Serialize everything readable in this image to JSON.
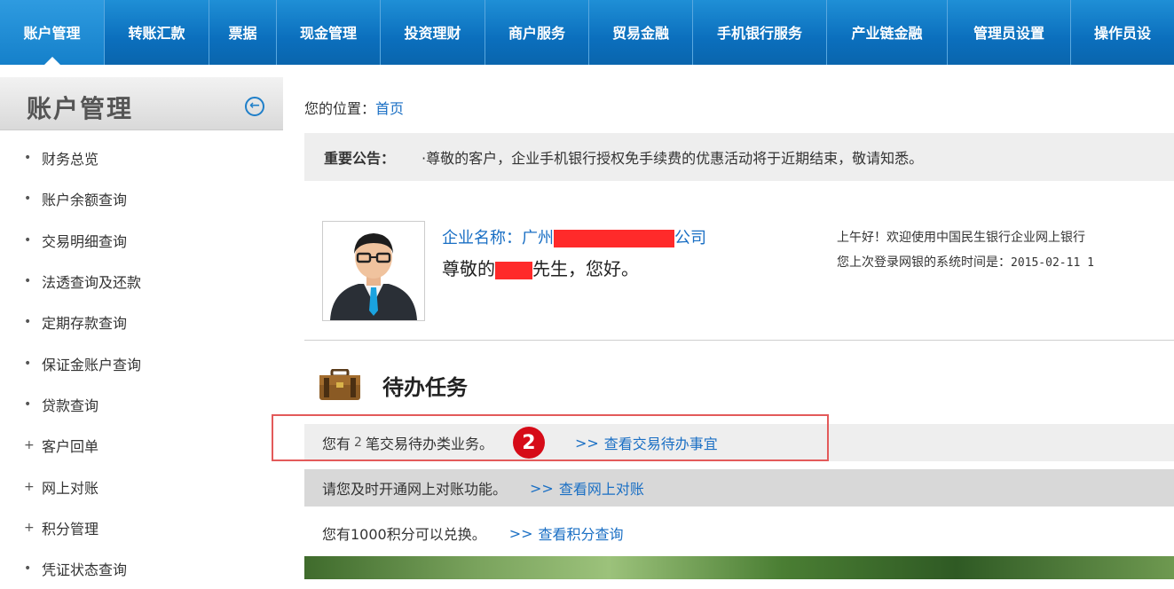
{
  "topnav": {
    "tabs": [
      {
        "label": "账户管理",
        "active": true
      },
      {
        "label": "转账汇款"
      },
      {
        "label": "票据"
      },
      {
        "label": "现金管理"
      },
      {
        "label": "投资理财"
      },
      {
        "label": "商户服务"
      },
      {
        "label": "贸易金融"
      },
      {
        "label": "手机银行服务"
      },
      {
        "label": "产业链金融"
      },
      {
        "label": "管理员设置"
      },
      {
        "label": "操作员设"
      }
    ]
  },
  "sidebar": {
    "title": "账户管理",
    "items": [
      {
        "mark": "•",
        "label": "财务总览"
      },
      {
        "mark": "•",
        "label": "账户余额查询"
      },
      {
        "mark": "•",
        "label": "交易明细查询"
      },
      {
        "mark": "•",
        "label": "法透查询及还款"
      },
      {
        "mark": "•",
        "label": "定期存款查询"
      },
      {
        "mark": "•",
        "label": "保证金账户查询"
      },
      {
        "mark": "•",
        "label": "贷款查询"
      },
      {
        "mark": "+",
        "label": "客户回单"
      },
      {
        "mark": "+",
        "label": "网上对账"
      },
      {
        "mark": "+",
        "label": "积分管理"
      },
      {
        "mark": "•",
        "label": "凭证状态查询"
      }
    ]
  },
  "breadcrumb": {
    "prefix": "您的位置：",
    "link": "首页"
  },
  "notice": {
    "label": "重要公告：",
    "text": "·尊敬的客户，企业手机银行授权免手续费的优惠活动将于近期结束，敬请知悉。"
  },
  "profile": {
    "company_prefix": "企业名称：广州",
    "company_suffix": "公司",
    "greet_prefix": "尊敬的",
    "greet_suffix": "先生，您好。",
    "welcome_line1": "上午好！欢迎使用中国民生银行企业网上银行",
    "welcome_line2_label": "您上次登录网银的系统时间是：",
    "welcome_line2_value": "2015-02-11 1"
  },
  "todo": {
    "title": "待办任务",
    "row1": {
      "prefix": "您有",
      "count": "2",
      "suffix": "笔交易待办类业务。",
      "badge": "2",
      "arrow": ">>",
      "link": "查看交易待办事宜"
    },
    "row2": {
      "text": "请您及时开通网上对账功能。",
      "arrow": ">>",
      "link": "查看网上对账"
    },
    "row3": {
      "text": "您有1000积分可以兑换。",
      "arrow": ">>",
      "link": "查看积分查询"
    }
  },
  "colors": {
    "nav_blue": "#0b6fbd",
    "link_blue": "#1a6fc4",
    "badge_red": "#d60b18",
    "highlight_red": "#e35a5a"
  }
}
